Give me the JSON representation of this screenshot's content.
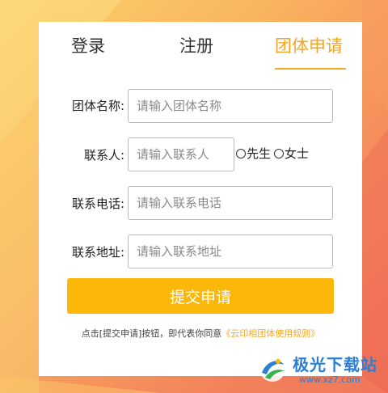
{
  "tabs": {
    "login": "登录",
    "register": "注册",
    "group_apply": "团体申请"
  },
  "form": {
    "group_name": {
      "label": "团体名称:",
      "placeholder": "请输入团体名称",
      "value": ""
    },
    "contact": {
      "label": "联系人:",
      "placeholder": "请输入联系人",
      "value": ""
    },
    "gender_options": [
      "先生",
      "女士"
    ],
    "phone": {
      "label": "联系电话:",
      "placeholder": "请输入联系电话",
      "value": ""
    },
    "address": {
      "label": "联系地址:",
      "placeholder": "请输入联系地址",
      "value": ""
    },
    "submit_label": "提交申请"
  },
  "agreement": {
    "text": "点击[提交申请]按钮，即代表你同意",
    "link": "《云印相团体使用规则》"
  },
  "watermark": {
    "title": "极光下载站",
    "url": "www.xz7.com"
  },
  "colors": {
    "accent": "#f6a623",
    "button": "#fbb70a",
    "watermark": "#2a7fd4"
  }
}
